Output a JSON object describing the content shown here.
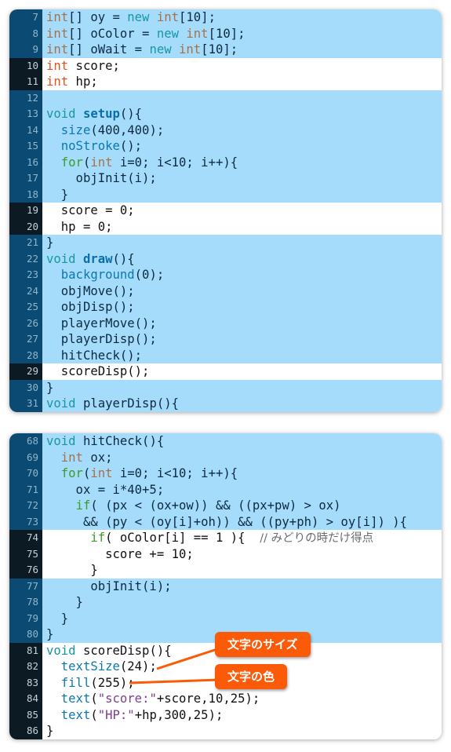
{
  "panels": [
    {
      "lines": [
        {
          "n": "7",
          "hl": true,
          "tokens": [
            [
              "int",
              "t"
            ],
            [
              "[] oy = ",
              ""
            ],
            [
              "new",
              "k"
            ],
            [
              " ",
              ""
            ],
            [
              "int",
              "t"
            ],
            [
              "[10];",
              ""
            ]
          ]
        },
        {
          "n": "8",
          "hl": true,
          "tokens": [
            [
              "int",
              "t"
            ],
            [
              "[] oColor = ",
              ""
            ],
            [
              "new",
              "k"
            ],
            [
              " ",
              ""
            ],
            [
              "int",
              "t"
            ],
            [
              "[10];",
              ""
            ]
          ]
        },
        {
          "n": "9",
          "hl": true,
          "tokens": [
            [
              "int",
              "t"
            ],
            [
              "[] oWait = ",
              ""
            ],
            [
              "new",
              "k"
            ],
            [
              " ",
              ""
            ],
            [
              "int",
              "t"
            ],
            [
              "[10];",
              ""
            ]
          ]
        },
        {
          "n": "10",
          "hl": false,
          "tokens": [
            [
              "int",
              "t2"
            ],
            [
              " score;",
              ""
            ]
          ]
        },
        {
          "n": "11",
          "hl": false,
          "tokens": [
            [
              "int",
              "t2"
            ],
            [
              " hp;",
              ""
            ]
          ]
        },
        {
          "n": "12",
          "hl": true,
          "tokens": []
        },
        {
          "n": "13",
          "hl": true,
          "tokens": [
            [
              "void",
              "k"
            ],
            [
              " ",
              ""
            ],
            [
              "setup",
              "fb"
            ],
            [
              "(){",
              ""
            ]
          ]
        },
        {
          "n": "14",
          "hl": true,
          "tokens": [
            [
              "  ",
              ""
            ],
            [
              "size",
              "f"
            ],
            [
              "(400,400);",
              ""
            ]
          ]
        },
        {
          "n": "15",
          "hl": true,
          "tokens": [
            [
              "  ",
              ""
            ],
            [
              "noStroke",
              "f"
            ],
            [
              "();",
              ""
            ]
          ]
        },
        {
          "n": "16",
          "hl": true,
          "tokens": [
            [
              "  ",
              ""
            ],
            [
              "for",
              "c"
            ],
            [
              "(",
              ""
            ],
            [
              "int",
              "t"
            ],
            [
              " i=0; i<10; i++){",
              ""
            ]
          ]
        },
        {
          "n": "17",
          "hl": true,
          "tokens": [
            [
              "    objInit(i);",
              ""
            ]
          ]
        },
        {
          "n": "18",
          "hl": true,
          "tokens": [
            [
              "  }",
              ""
            ]
          ]
        },
        {
          "n": "19",
          "hl": false,
          "tokens": [
            [
              "  score = 0;",
              ""
            ]
          ]
        },
        {
          "n": "20",
          "hl": false,
          "tokens": [
            [
              "  hp = 0;",
              ""
            ]
          ]
        },
        {
          "n": "21",
          "hl": true,
          "tokens": [
            [
              "}",
              ""
            ]
          ]
        },
        {
          "n": "22",
          "hl": true,
          "tokens": [
            [
              "void",
              "k"
            ],
            [
              " ",
              ""
            ],
            [
              "draw",
              "fb"
            ],
            [
              "(){",
              ""
            ]
          ]
        },
        {
          "n": "23",
          "hl": true,
          "tokens": [
            [
              "  ",
              ""
            ],
            [
              "background",
              "f"
            ],
            [
              "(0);",
              ""
            ]
          ]
        },
        {
          "n": "24",
          "hl": true,
          "tokens": [
            [
              "  objMove();",
              ""
            ]
          ]
        },
        {
          "n": "25",
          "hl": true,
          "tokens": [
            [
              "  objDisp();",
              ""
            ]
          ]
        },
        {
          "n": "26",
          "hl": true,
          "tokens": [
            [
              "  playerMove();",
              ""
            ]
          ]
        },
        {
          "n": "27",
          "hl": true,
          "tokens": [
            [
              "  playerDisp();",
              ""
            ]
          ]
        },
        {
          "n": "28",
          "hl": true,
          "tokens": [
            [
              "  hitCheck();",
              ""
            ]
          ]
        },
        {
          "n": "29",
          "hl": false,
          "tokens": [
            [
              "  scoreDisp();",
              ""
            ]
          ]
        },
        {
          "n": "30",
          "hl": true,
          "tokens": [
            [
              "}",
              ""
            ]
          ]
        },
        {
          "n": "31",
          "hl": true,
          "tokens": [
            [
              "void",
              "k"
            ],
            [
              " playerDisp(){",
              ""
            ]
          ]
        }
      ]
    },
    {
      "lines": [
        {
          "n": "68",
          "hl": true,
          "tokens": [
            [
              "void",
              "k"
            ],
            [
              " hitCheck(){",
              ""
            ]
          ]
        },
        {
          "n": "69",
          "hl": true,
          "tokens": [
            [
              "  ",
              ""
            ],
            [
              "int",
              "t"
            ],
            [
              " ox;",
              ""
            ]
          ]
        },
        {
          "n": "70",
          "hl": true,
          "tokens": [
            [
              "  ",
              ""
            ],
            [
              "for",
              "c"
            ],
            [
              "(",
              ""
            ],
            [
              "int",
              "t"
            ],
            [
              " i=0; i<10; i++){",
              ""
            ]
          ]
        },
        {
          "n": "71",
          "hl": true,
          "tokens": [
            [
              "    ox = i*40+5;",
              ""
            ]
          ]
        },
        {
          "n": "72",
          "hl": true,
          "tokens": [
            [
              "    ",
              ""
            ],
            [
              "if",
              "c"
            ],
            [
              "( (px < (ox+ow)) && ((px+pw) > ox)",
              ""
            ]
          ]
        },
        {
          "n": "73",
          "hl": true,
          "tokens": [
            [
              "     && (py < (oy[i]+oh)) && ((py+ph) > oy[i]) ){",
              ""
            ]
          ]
        },
        {
          "n": "74",
          "hl": false,
          "tokens": [
            [
              "      ",
              ""
            ],
            [
              "if",
              "c"
            ],
            [
              "( oColor[i] == 1 ){  ",
              ""
            ],
            [
              "// みどりの時だけ得点",
              "cm"
            ]
          ]
        },
        {
          "n": "75",
          "hl": false,
          "tokens": [
            [
              "        score += 10;",
              ""
            ]
          ]
        },
        {
          "n": "76",
          "hl": false,
          "tokens": [
            [
              "      }",
              ""
            ]
          ]
        },
        {
          "n": "77",
          "hl": true,
          "tokens": [
            [
              "      objInit(i);",
              ""
            ]
          ]
        },
        {
          "n": "78",
          "hl": true,
          "tokens": [
            [
              "    }",
              ""
            ]
          ]
        },
        {
          "n": "79",
          "hl": true,
          "tokens": [
            [
              "  }",
              ""
            ]
          ]
        },
        {
          "n": "80",
          "hl": true,
          "tokens": [
            [
              "}",
              ""
            ]
          ]
        },
        {
          "n": "81",
          "hl": false,
          "tokens": [
            [
              "void",
              "k"
            ],
            [
              " scoreDisp(){",
              ""
            ]
          ]
        },
        {
          "n": "82",
          "hl": false,
          "tokens": [
            [
              "  ",
              ""
            ],
            [
              "textSize",
              "f"
            ],
            [
              "(24);",
              ""
            ]
          ]
        },
        {
          "n": "83",
          "hl": false,
          "tokens": [
            [
              "  ",
              ""
            ],
            [
              "fill",
              "f"
            ],
            [
              "(255);",
              ""
            ]
          ]
        },
        {
          "n": "84",
          "hl": false,
          "tokens": [
            [
              "  ",
              ""
            ],
            [
              "text",
              "f"
            ],
            [
              "(",
              ""
            ],
            [
              "\"score:\"",
              "s"
            ],
            [
              "+score,10,25);",
              ""
            ]
          ]
        },
        {
          "n": "85",
          "hl": false,
          "tokens": [
            [
              "  ",
              ""
            ],
            [
              "text",
              "f"
            ],
            [
              "(",
              ""
            ],
            [
              "\"HP:\"",
              "s"
            ],
            [
              "+hp,300,25);",
              ""
            ]
          ]
        },
        {
          "n": "86",
          "hl": false,
          "tokens": [
            [
              "}",
              ""
            ]
          ]
        }
      ]
    }
  ],
  "callouts": {
    "text_size": "文字のサイズ",
    "text_color": "文字の色"
  },
  "colors": {
    "highlight_row": "#a6dcfb",
    "gutter_highlight": "#0b4a72",
    "gutter_plain": "#0c1a24",
    "callout": "#fb5a08"
  }
}
